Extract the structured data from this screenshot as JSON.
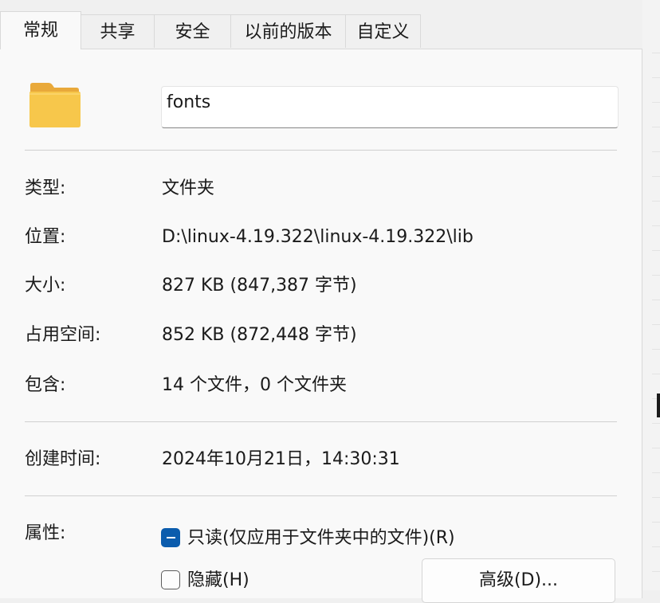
{
  "tabs": [
    {
      "label": "常规",
      "active": true
    },
    {
      "label": "共享",
      "active": false
    },
    {
      "label": "安全",
      "active": false
    },
    {
      "label": "以前的版本",
      "active": false
    },
    {
      "label": "自定义",
      "active": false
    }
  ],
  "folder": {
    "icon": "folder-icon",
    "name": "fonts"
  },
  "details": {
    "type_label": "类型:",
    "type_value": "文件夹",
    "location_label": "位置:",
    "location_value": "D:\\linux-4.19.322\\linux-4.19.322\\lib",
    "size_label": "大小:",
    "size_value": "827 KB (847,387 字节)",
    "disk_label": "占用空间:",
    "disk_value": "852 KB (872,448 字节)",
    "contains_label": "包含:",
    "contains_value": "14 个文件，0 个文件夹"
  },
  "created": {
    "label": "创建时间:",
    "value": "2024年10月21日，14:30:31"
  },
  "attributes": {
    "label": "属性:",
    "readonly_label": "只读(仅应用于文件夹中的文件)(R)",
    "readonly_state": "indeterminate",
    "hidden_label": "隐藏(H)",
    "hidden_checked": false,
    "advanced_button": "高级(D)..."
  },
  "colors": {
    "accent": "#0b5cad",
    "folder": "#f6c344",
    "background": "#f9f9f9"
  }
}
